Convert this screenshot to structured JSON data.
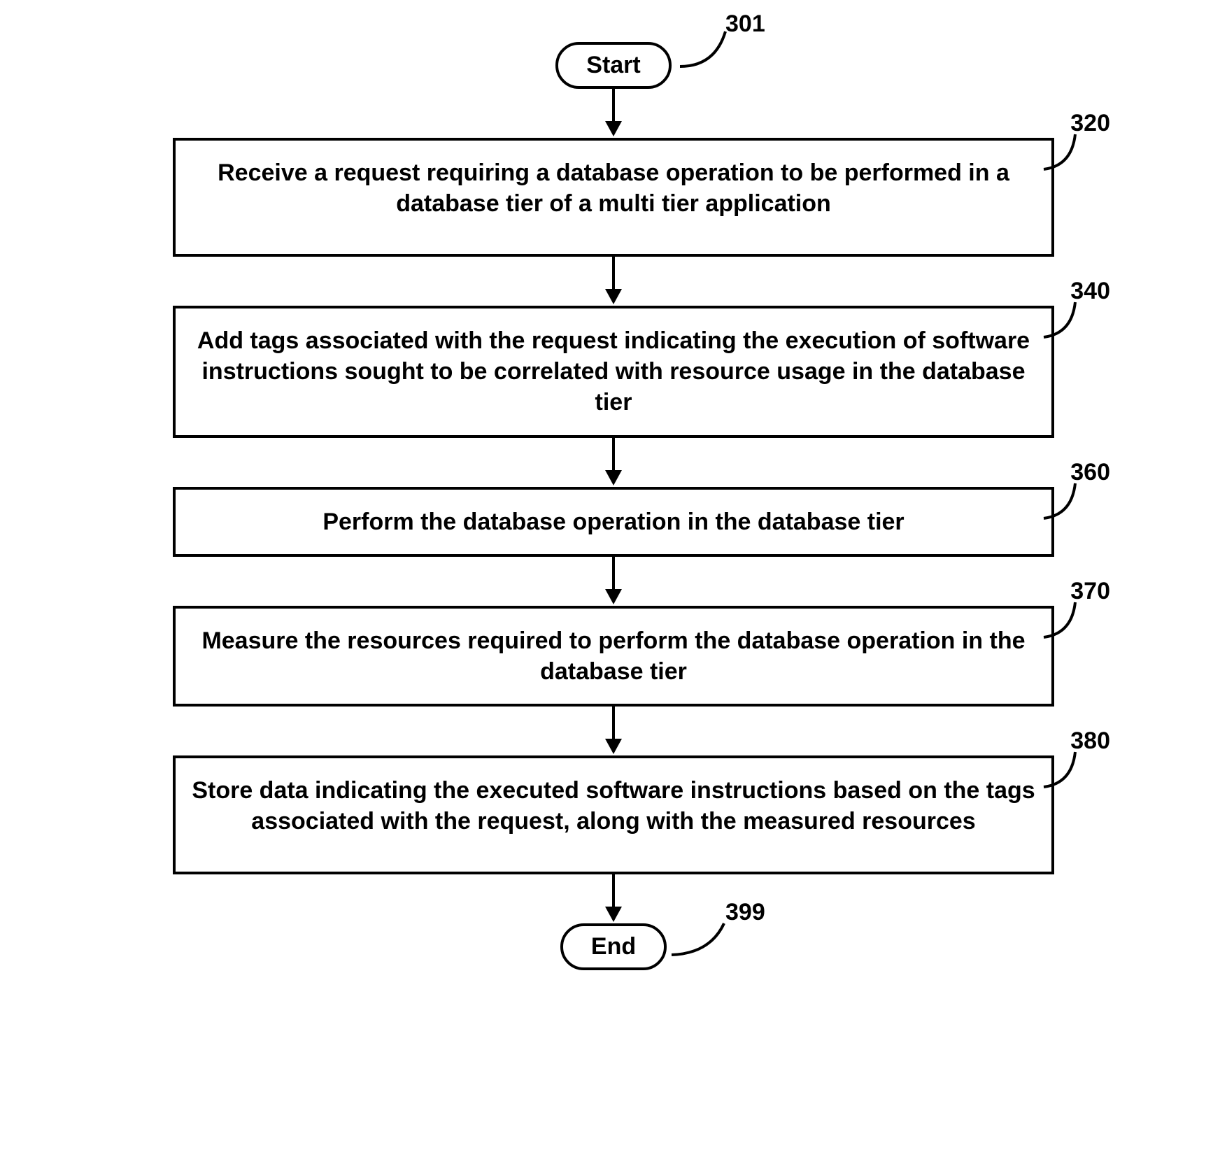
{
  "flow": {
    "start": {
      "label": "Start",
      "ref": "301"
    },
    "steps": [
      {
        "ref": "320",
        "text": "Receive a request requiring a database operation to be performed in a database tier of a multi tier application"
      },
      {
        "ref": "340",
        "text": "Add tags associated with the request indicating the execution of software instructions sought to be correlated with resource usage in the database tier"
      },
      {
        "ref": "360",
        "text": "Perform the database operation in the database tier"
      },
      {
        "ref": "370",
        "text": "Measure the resources required to perform the database operation in the database tier"
      },
      {
        "ref": "380",
        "text": "Store data indicating the executed software instructions based on the tags associated with the request, along with the measured resources"
      }
    ],
    "end": {
      "label": "End",
      "ref": "399"
    }
  }
}
